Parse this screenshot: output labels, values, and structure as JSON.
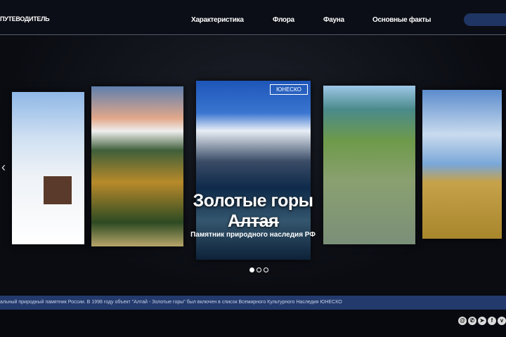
{
  "header": {
    "logo": "ПУТЕВОДИТЕЛЬ",
    "nav": [
      "Характеристика",
      "Флора",
      "Фауна",
      "Основные факты"
    ]
  },
  "hero": {
    "badge": "ЮНЕСКО",
    "title": "Золотые горы Алтая",
    "subtitle": "Памятник природного наследия РФ",
    "slides_total": 3,
    "active_slide": 1
  },
  "ticker": "альный природный памятник России. В 1998 году объект \"Алтай - Золотые горы\" был включен в список Всемирного Культурного Наследия ЮНЕСКО",
  "social": [
    {
      "icon": "mail-icon",
      "glyph": "@"
    },
    {
      "icon": "phone-icon",
      "glyph": "✆"
    },
    {
      "icon": "telegram-icon",
      "glyph": "➤"
    },
    {
      "icon": "facebook-icon",
      "glyph": "f"
    },
    {
      "icon": "vk-icon",
      "glyph": "v"
    }
  ],
  "colors": {
    "accent": "#233a6c",
    "background": "#07090f"
  }
}
